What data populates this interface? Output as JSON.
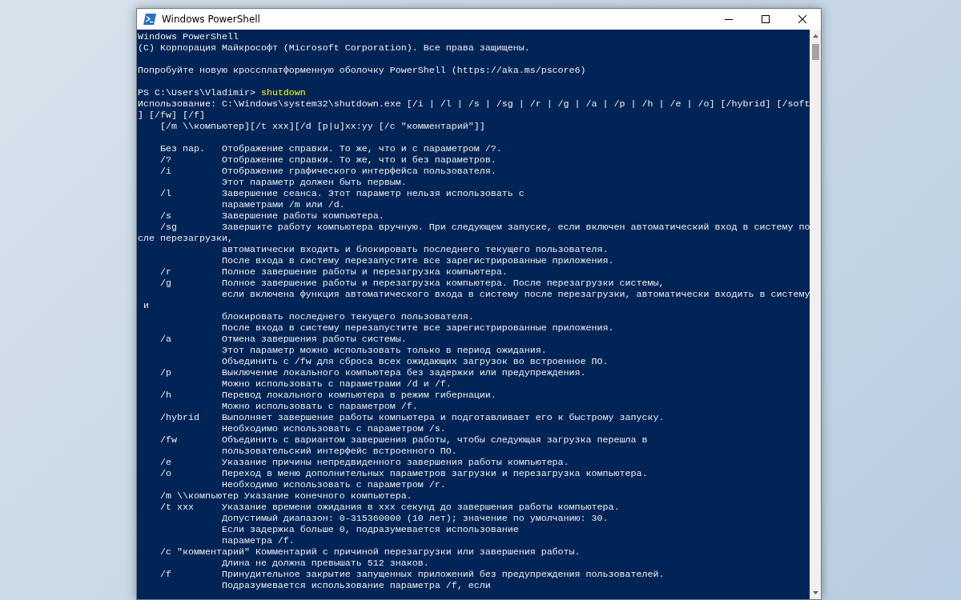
{
  "window": {
    "title": "Windows PowerShell"
  },
  "console": {
    "lines": [
      {
        "kind": "text",
        "text": "Windows PowerShell"
      },
      {
        "kind": "text",
        "text": "(C) Корпорация Майкрософт (Microsoft Corporation). Все права защищены."
      },
      {
        "kind": "blank"
      },
      {
        "kind": "text",
        "text": "Попробуйте новую кроссплатформенную оболочку PowerShell (https://aka.ms/pscore6)"
      },
      {
        "kind": "blank"
      },
      {
        "kind": "prompt",
        "prompt": "PS C:\\Users\\Vladimir> ",
        "command": "shutdown"
      },
      {
        "kind": "text",
        "text": "Использование: C:\\Windows\\system32\\shutdown.exe [/i | /l | /s | /sg | /r | /g | /a | /p | /h | /e | /o] [/hybrid] [/soft"
      },
      {
        "kind": "text",
        "text": "] [/fw] [/f]"
      },
      {
        "kind": "text",
        "text": "    [/m \\\\компьютер][/t xxx][/d [p|u]xx:yy [/c \"комментарий\"]]"
      },
      {
        "kind": "blank"
      },
      {
        "kind": "text",
        "text": "    Без пар.   Отображение справки. То же, что и с параметром /?."
      },
      {
        "kind": "text",
        "text": "    /?         Отображение справки. То же, что и без параметров."
      },
      {
        "kind": "text",
        "text": "    /i         Отображение графического интерфейса пользователя."
      },
      {
        "kind": "text",
        "text": "               Этот параметр должен быть первым."
      },
      {
        "kind": "text",
        "text": "    /l         Завершение сеанса. Этот параметр нельзя использовать с"
      },
      {
        "kind": "text",
        "text": "               параметрами /m или /d."
      },
      {
        "kind": "text",
        "text": "    /s         Завершение работы компьютера."
      },
      {
        "kind": "text",
        "text": "    /sg        Завершите работу компьютера вручную. При следующем запуске, если включен автоматический вход в систему по"
      },
      {
        "kind": "text",
        "text": "сле перезагрузки,"
      },
      {
        "kind": "text",
        "text": "               автоматически входить и блокировать последнего текущего пользователя."
      },
      {
        "kind": "text",
        "text": "               После входа в систему перезапустите все зарегистрированные приложения."
      },
      {
        "kind": "text",
        "text": "    /r         Полное завершение работы и перезагрузка компьютера."
      },
      {
        "kind": "text",
        "text": "    /g         Полное завершение работы и перезагрузка компьютера. После перезагрузки системы,"
      },
      {
        "kind": "text",
        "text": "               если включена функция автоматического входа в систему после перезагрузки, автоматически входить в систему"
      },
      {
        "kind": "text",
        "text": " и"
      },
      {
        "kind": "text",
        "text": "               блокировать последнего текущего пользователя."
      },
      {
        "kind": "text",
        "text": "               После входа в систему перезапустите все зарегистрированные приложения."
      },
      {
        "kind": "text",
        "text": "    /a         Отмена завершения работы системы."
      },
      {
        "kind": "text",
        "text": "               Этот параметр можно использовать только в период ожидания."
      },
      {
        "kind": "text",
        "text": "               Объединить с /fw для сброса всех ожидающих загрузок во встроенное ПО."
      },
      {
        "kind": "text",
        "text": "    /p         Выключение локального компьютера без задержки или предупреждения."
      },
      {
        "kind": "text",
        "text": "               Можно использовать с параметрами /d и /f."
      },
      {
        "kind": "text",
        "text": "    /h         Перевод локального компьютера в режим гибернации."
      },
      {
        "kind": "text",
        "text": "               Можно использовать с параметром /f."
      },
      {
        "kind": "text",
        "text": "    /hybrid    Выполняет завершение работы компьютера и подготавливает его к быстрому запуску."
      },
      {
        "kind": "text",
        "text": "               Необходимо использовать с параметром /s."
      },
      {
        "kind": "text",
        "text": "    /fw        Объединить с вариантом завершения работы, чтобы следующая загрузка перешла в"
      },
      {
        "kind": "text",
        "text": "               пользовательский интерфейс встроенного ПО."
      },
      {
        "kind": "text",
        "text": "    /e         Указание причины непредвиденного завершения работы компьютера."
      },
      {
        "kind": "text",
        "text": "    /o         Переход в меню дополнительных параметров загрузки и перезагрузка компьютера."
      },
      {
        "kind": "text",
        "text": "               Необходимо использовать с параметром /r."
      },
      {
        "kind": "text",
        "text": "    /m \\\\компьютер Указание конечного компьютера."
      },
      {
        "kind": "text",
        "text": "    /t xxx     Указание времени ожидания в xxx секунд до завершения работы компьютера."
      },
      {
        "kind": "text",
        "text": "               Допустимый диапазон: 0-315360000 (10 лет); значение по умолчанию: 30."
      },
      {
        "kind": "text",
        "text": "               Если задержка больше 0, подразумевается использование"
      },
      {
        "kind": "text",
        "text": "               параметра /f."
      },
      {
        "kind": "text",
        "text": "    /c \"комментарий\" Комментарий с причиной перезагрузки или завершения работы."
      },
      {
        "kind": "text",
        "text": "               Длина не должна превышать 512 знаков."
      },
      {
        "kind": "text",
        "text": "    /f         Принудительное закрытие запущенных приложений без предупреждения пользователей."
      },
      {
        "kind": "text",
        "text": "               Подразумевается использование параметра /f, если"
      }
    ]
  }
}
